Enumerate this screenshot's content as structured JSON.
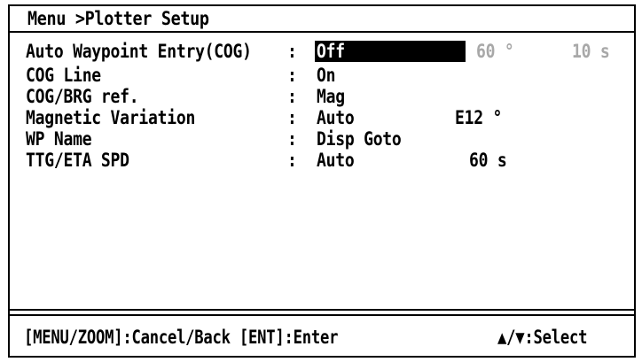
{
  "header": {
    "breadcrumb": "Menu >Plotter Setup"
  },
  "settings": [
    {
      "label": "Auto Waypoint Entry(COG)",
      "colon": ":",
      "value": "Off",
      "extra": "60 °",
      "extra2": "10 s"
    },
    {
      "label": "COG Line",
      "colon": ":",
      "value": "On"
    },
    {
      "label": "COG/BRG ref.",
      "colon": ":",
      "value": "Mag"
    },
    {
      "label": "Magnetic Variation",
      "colon": ":",
      "value": "Auto",
      "extra": "E12 °"
    },
    {
      "label": "WP Name",
      "colon": ":",
      "value": "Disp Goto"
    },
    {
      "label": "TTG/ETA SPD",
      "colon": ":",
      "value": "Auto",
      "extra": "60 s"
    }
  ],
  "footer": {
    "left": "[MENU/ZOOM]:Cancel/Back [ENT]:Enter",
    "right": "▲/▼:Select"
  },
  "colors": {
    "background": "#ffffff",
    "foreground": "#000000",
    "disabled": "#a8a8a8"
  }
}
